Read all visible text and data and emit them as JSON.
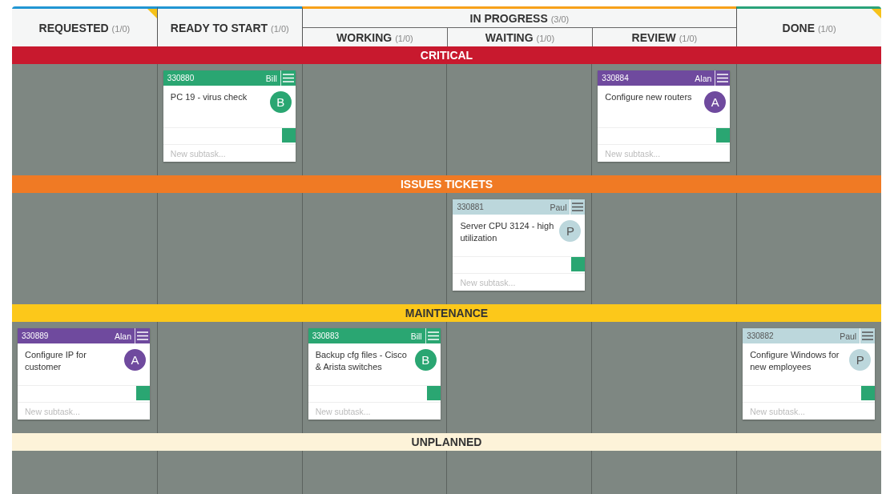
{
  "columns": [
    {
      "kind": "column",
      "title": "REQUESTED",
      "count": "(1/0)",
      "color": "#2196d3",
      "flagged": true
    },
    {
      "kind": "column",
      "title": "READY TO START",
      "count": "(1/0)",
      "color": "#2196d3",
      "flagged": false
    },
    {
      "kind": "group",
      "title": "IN PROGRESS",
      "count": "(3/0)",
      "color": "#f7a11a",
      "flagged": false,
      "children": [
        {
          "title": "WORKING",
          "count": "(1/0)"
        },
        {
          "title": "WAITING",
          "count": "(1/0)"
        },
        {
          "title": "REVIEW",
          "count": "(1/0)"
        }
      ]
    },
    {
      "kind": "column",
      "title": "DONE",
      "count": "(1/0)",
      "color": "#2aa37a",
      "flagged": true
    }
  ],
  "lanes": [
    {
      "title": "CRITICAL",
      "color": "#c8192e",
      "cells": [
        null,
        {
          "number": "330880",
          "owner": "Bill",
          "initial": "B",
          "title": "PC 19 - virus check",
          "color": "#2aa672",
          "subtask_placeholder": "New subtask..."
        },
        null,
        null,
        {
          "number": "330884",
          "owner": "Alan",
          "initial": "A",
          "title": "Configure new routers",
          "color": "#6f4a9e",
          "subtask_placeholder": "New subtask..."
        },
        null
      ]
    },
    {
      "title": "ISSUES TICKETS",
      "color": "#f07a24",
      "cells": [
        null,
        null,
        null,
        {
          "number": "330881",
          "owner": "Paul",
          "initial": "P",
          "title": "Server CPU 3124 - high utilization",
          "color": "#bcd7dc",
          "subtask_placeholder": "New subtask..."
        },
        null,
        null
      ]
    },
    {
      "title": "MAINTENANCE",
      "color": "#fcc81a",
      "cells": [
        {
          "number": "330889",
          "owner": "Alan",
          "initial": "A",
          "title": "Configure IP for customer",
          "color": "#6f4a9e",
          "subtask_placeholder": "New subtask..."
        },
        null,
        {
          "number": "330883",
          "owner": "Bill",
          "initial": "B",
          "title": "Backup cfg files - Cisco & Arista switches",
          "color": "#2aa672",
          "subtask_placeholder": "New subtask..."
        },
        null,
        null,
        {
          "number": "330882",
          "owner": "Paul",
          "initial": "P",
          "title": "Configure Windows for new employees",
          "color": "#bcd7dc",
          "subtask_placeholder": "New subtask..."
        }
      ]
    },
    {
      "title": "UNPLANNED",
      "color": "#fdf3d9",
      "cells": [
        null,
        null,
        null,
        null,
        null,
        null
      ]
    }
  ]
}
